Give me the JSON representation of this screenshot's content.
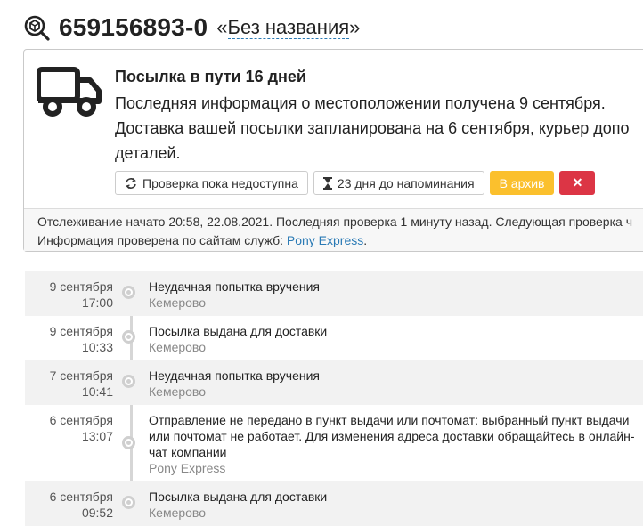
{
  "header": {
    "tracking_number": "659156893-0",
    "quote_open": "«",
    "name": "Без названия",
    "quote_close": "»"
  },
  "card": {
    "title": "Посылка в пути 16 дней",
    "line1": "Последняя информация о местоположении получена 9 сентября.",
    "line2": "Доставка вашей посылки запланирована на 6 сентября, курьер допо",
    "line3": "деталей.",
    "buttons": {
      "check": "Проверка пока недоступна",
      "reminder": "23 дня до напоминания",
      "archive": "В архив",
      "delete": "✕"
    }
  },
  "footer": {
    "line1": "Отслеживание начато 20:58, 22.08.2021. Последняя проверка 1 минуту назад. Следующая проверка ч",
    "line2_prefix": "Информация проверена по сайтам служб: ",
    "service_link": "Pony Express",
    "line2_suffix": "."
  },
  "events": [
    {
      "date": "9 сентября",
      "time": "17:00",
      "text": "Неудачная попытка вручения",
      "place": "Кемерово"
    },
    {
      "date": "9 сентября",
      "time": "10:33",
      "text": "Посылка выдана для доставки",
      "place": "Кемерово"
    },
    {
      "date": "7 сентября",
      "time": "10:41",
      "text": "Неудачная попытка вручения",
      "place": "Кемерово"
    },
    {
      "date": "6 сентября",
      "time": "13:07",
      "text": "Отправление не передано в пункт выдачи или почтомат: выбранный пункт выдачи или почтомат не работает. Для изменения адреса доставки обращайтесь в онлайн-чат компании",
      "place": "Pony Express"
    },
    {
      "date": "6 сентября",
      "time": "09:52",
      "text": "Посылка выдана для доставки",
      "place": "Кемерово"
    }
  ],
  "icons": {
    "logo": "parcel-search-icon",
    "truck": "truck-icon",
    "refresh": "refresh-icon",
    "hourglass": "hourglass-icon"
  },
  "colors": {
    "warning": "#fbc02d",
    "danger": "#dc3545",
    "link": "#2a7ab5"
  }
}
